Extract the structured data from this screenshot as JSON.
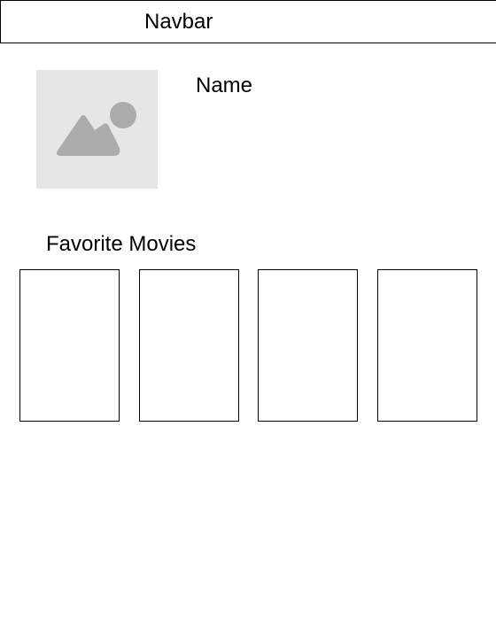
{
  "navbar": {
    "label": "Navbar"
  },
  "profile": {
    "avatar_icon": "image-placeholder-icon",
    "name": "Name"
  },
  "favorites": {
    "title": "Favorite Movies",
    "card_count": 4
  },
  "colors": {
    "border": "#000000",
    "placeholder_bg": "#e6e6e6",
    "placeholder_icon": "#ababab"
  }
}
